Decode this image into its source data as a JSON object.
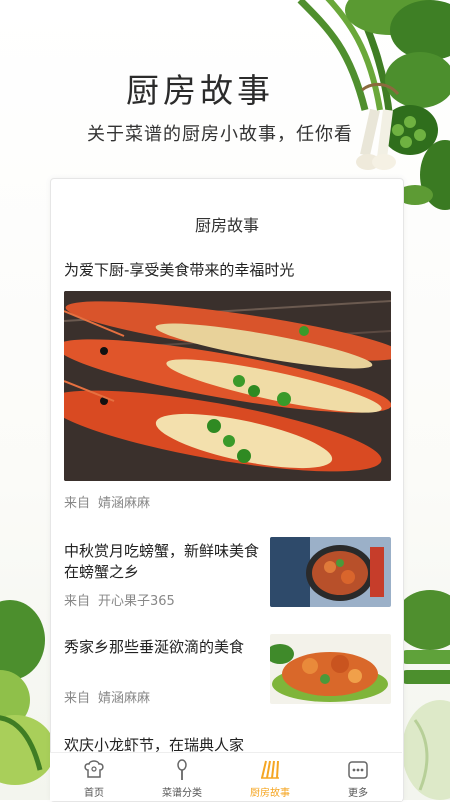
{
  "header": {
    "title": "厨房故事",
    "subtitle": "关于菜谱的厨房小故事，任你看"
  },
  "card": {
    "title": "厨房故事",
    "featured": {
      "title": "为爱下厨-享受美食带来的幸福时光",
      "source_label": "来自",
      "author": "婧涵麻麻"
    },
    "articles": [
      {
        "title": "中秋赏月吃螃蟹，新鲜味美食在螃蟹之乡",
        "source_label": "来自",
        "author": "开心果子365"
      },
      {
        "title": "秀家乡那些垂涎欲滴的美食",
        "source_label": "来自",
        "author": "婧涵麻麻"
      },
      {
        "title": "欢庆小龙虾节，在瑞典人家"
      }
    ]
  },
  "tabbar": {
    "items": [
      {
        "label": "首页",
        "icon": "chef-hat-icon"
      },
      {
        "label": "菜谱分类",
        "icon": "spoon-icon"
      },
      {
        "label": "厨房故事",
        "icon": "book-icon",
        "active": true
      },
      {
        "label": "更多",
        "icon": "more-icon"
      }
    ],
    "active_color": "#f5a623"
  }
}
